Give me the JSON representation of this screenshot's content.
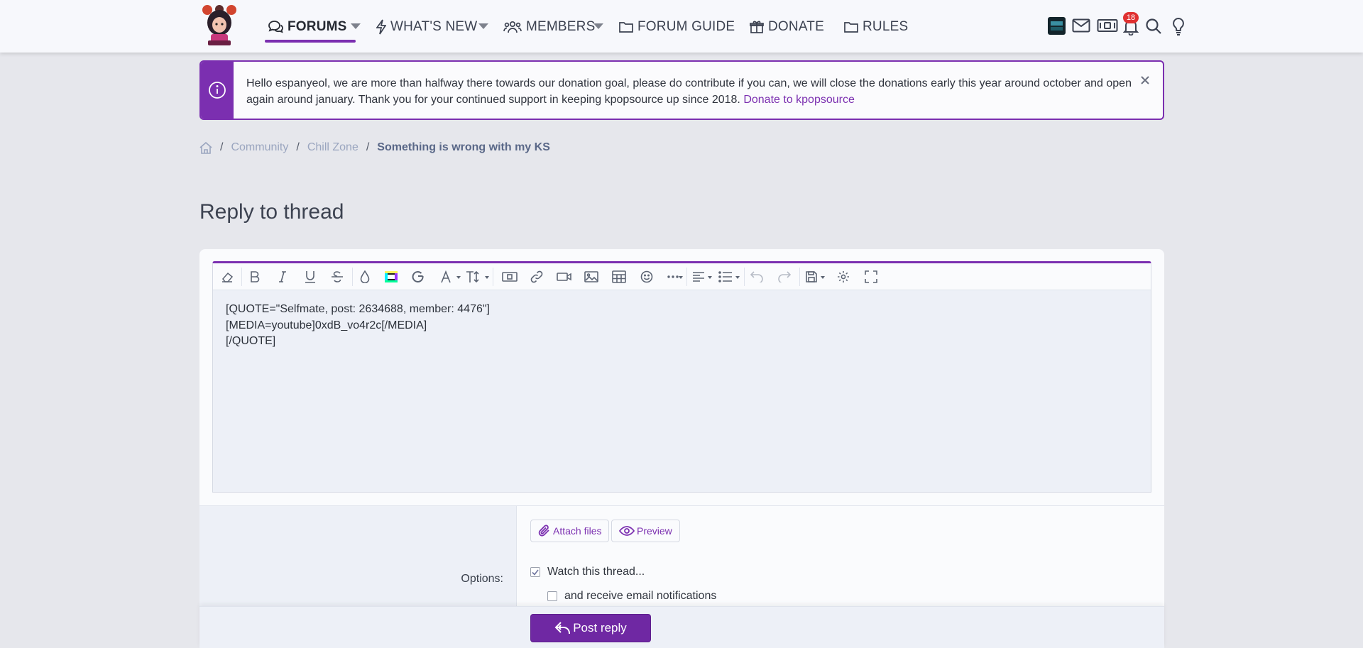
{
  "nav": {
    "items": [
      {
        "label": "FORUMS",
        "icon": "chat-bubbles-icon",
        "active": true
      },
      {
        "label": "WHAT'S NEW",
        "icon": "lightning-icon"
      },
      {
        "label": "MEMBERS",
        "icon": "users-icon"
      },
      {
        "label": "FORUM GUIDE",
        "icon": "folder-icon"
      },
      {
        "label": "DONATE",
        "icon": "gift-icon"
      },
      {
        "label": "RULES",
        "icon": "folder-icon"
      }
    ],
    "notification_count": "18",
    "accent": "#7b2fb0"
  },
  "notice": {
    "text": "Hello espanyeol, we are more than halfway there towards our donation goal, please do contribute if you can, we will close the donations early this year around october and open again around january. Thank you for your continued support in keeping kpopsource up since 2018. ",
    "link": "Donate to kpopsource"
  },
  "breadcrumb": {
    "items": [
      "Community",
      "Chill Zone"
    ],
    "current": "Something is wrong with my KS"
  },
  "page": {
    "title": "Reply to thread"
  },
  "editor": {
    "content": "[QUOTE=\"Selfmate, post: 2634688, member: 4476\"]\n[MEDIA=youtube]0xdB_vo4r2c[/MEDIA]\n[/QUOTE]"
  },
  "form": {
    "attach_label": "Attach files",
    "preview_label": "Preview",
    "options_label": "Options:",
    "watch_label": "Watch this thread...",
    "watch_checked": true,
    "email_label": "and receive email notifications",
    "email_checked": false
  },
  "footer": {
    "post_label": "Post reply"
  }
}
